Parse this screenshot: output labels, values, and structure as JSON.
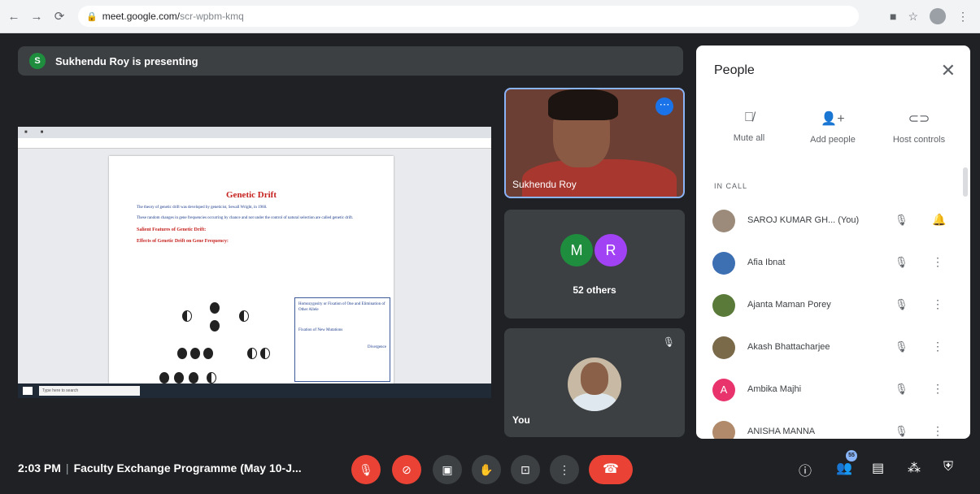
{
  "browser": {
    "url_host": "meet.google.com/",
    "url_path": "scr-wpbm-kmq"
  },
  "presenting_banner": {
    "initial": "S",
    "text": "Sukhendu Roy is presenting"
  },
  "shared_screen": {
    "doc_title": "Genetic Drift",
    "doc_para1": "The theory of genetic drift was developed by geneticist, Sewall Wright, in 1960.",
    "doc_para2": "These random changes in gene frequencies occurring by chance and not under the control of natural selection are called genetic drift.",
    "doc_sub1": "Salient Features of Genetic Drift:",
    "doc_sub2": "Effects of Genetic Drift on Gene Frequency:",
    "doc_box_text": "Homozygosity or Fixation of One and Elimination of Other Allele",
    "doc_box_text2": "Fixation of New Mutations",
    "doc_box_text3": "Divergence",
    "taskbar_search": "Type here to search"
  },
  "tiles": {
    "presenter_name": "Sukhendu Roy",
    "others_initial_1": "M",
    "others_initial_2": "R",
    "others_count": "52 others",
    "self_label": "You"
  },
  "people_panel": {
    "title": "People",
    "actions": [
      {
        "label": "Mute all",
        "icon": "mic-off-icon"
      },
      {
        "label": "Add people",
        "icon": "add-person-icon"
      },
      {
        "label": "Host controls",
        "icon": "toggle-icon"
      }
    ],
    "section_label": "IN CALL",
    "participants": [
      {
        "name": "SAROJ KUMAR GH...",
        "suffix": "(You)",
        "color": "#9c8b7a"
      },
      {
        "name": "Afia Ibnat",
        "suffix": "",
        "color": "#3d6fb3"
      },
      {
        "name": "Ajanta Maman Porey",
        "suffix": "",
        "color": "#5a7a3a"
      },
      {
        "name": "Akash Bhattacharjee",
        "suffix": "",
        "color": "#7a6a4a"
      },
      {
        "name": "Ambika Majhi",
        "suffix": "",
        "color": "#e8336d"
      },
      {
        "name": "ANISHA MANNA",
        "suffix": "",
        "color": "#b08a6a"
      }
    ],
    "ambika_initial": "A"
  },
  "bottom_bar": {
    "time": "2:03 PM",
    "meeting_title": "Faculty Exchange Programme (May 10-J...",
    "participant_count": "55"
  }
}
